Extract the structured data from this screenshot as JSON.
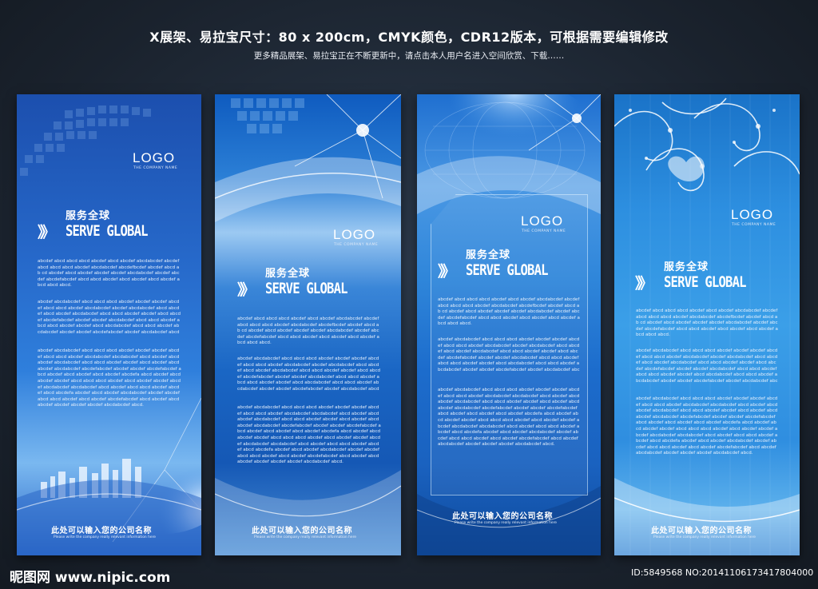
{
  "header": {
    "title": "X展架、易拉宝尺寸：80 x 200cm，CMYK颜色，CDR12版本，可根据需要编辑修改",
    "subtitle": "更多精品展架、易拉宝正在不断更新中，请点击本人用户名进入空间欣赏、下载……"
  },
  "panel_common": {
    "logo": "LOGO",
    "logo_sub": "THE COMPANY NAME",
    "serve_cn": "服务全球",
    "serve_en": "SERVE GLOBAL",
    "chevrons": "》》",
    "company_cn": "此处可以输入您的公司名称",
    "company_en": "Please write the company really relevant information here",
    "body_para1": "abcdef abcd abcd abcd abcdef abcd abcdef abcdabcdef abcdef abcd abcd abcd abcdef abcdabcdef abcdefbcdef abcdef abcd ab cd abcdef abcd abcdef abcdef abcdef abcdabcdef abcdef abcdef abcdefabcdef abcd abcd abcdef abcd abcdef abcd abcdef abcd abcd abcd.",
    "body_para2": "abcdef abcdabcdef abcd abcd abcd abcdef abcdef abcdef abcdef abcd abcd abcdef abcdabcdef abcdef abcdabcdef abcd abcdef abcd abcdef abcdabcdef abcd abcd abcdef abcdef abcd abcdef abcdefabcdef abcdef abcdef abcdabcdef abcd abcd abcdef abcd abcd abcdef abcdef abcd abcdabcdef abcd abcd abcdef abcdabcdef abcdef abcdef abcdefabcdef abcdef abcdabcdef abcdef abcdabcdef.",
    "body_para3": "abcdef abcdabcdef abcd abcd abcd abcdef abcdef abcdef abcdef abcd abcd abcdef abcdabcdef abcdabcdef abcd abcdef abcd abcdef abcdabcdef abcd abcd abcdef abcdef abcd abcdef abcd abcdef abcdabcdef abcdefabcdef abcdef abcdef abcdefabcdef abcd abcdef abcd abcdef abcd abcdef abcdefa abcd abcdef abcd abcdef abcdef abcd abcd abcd abcdef abcd abcdef abcdef abcdef abcdabcdef abcdabcdef abcd abcdef abcd abcd abcdef abcdef abcd abcdefa abcdef abcd abcdef abcdabcdef abcdef abcdef abcd abcd abcdef abcd abcdef abcdefabcdef abcd abcdef abcdabcdef abcdef abcdef abcdef abcdabcdef abcd."
  },
  "watermark": {
    "site": "昵图网 www.nipic.com",
    "id": "ID:5849568 NO:20141106173417804000"
  },
  "colors": {
    "background": "#1b2430",
    "panel_blue": "#1f6fd0"
  }
}
